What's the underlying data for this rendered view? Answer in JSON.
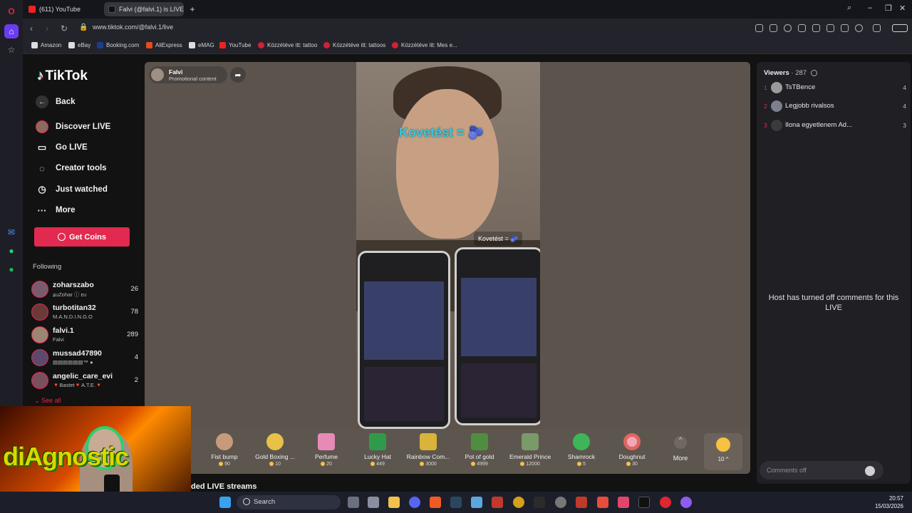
{
  "browser": {
    "tabs": [
      {
        "title": "(611) YouTube"
      },
      {
        "title": "Falvi (@falvi.1) is LIVE"
      }
    ],
    "url": "www.tiktok.com/@falvi.1/live",
    "bookmarks": [
      "Amazon",
      "eBay",
      "Booking.com",
      "AliExpress",
      "eMAG",
      "YouTube",
      "Közzétéve itt: tattoo",
      "Közzétéve itt: tattoos",
      "Közzétéve itt: Mes e..."
    ]
  },
  "sidebar": {
    "logo": "TikTok",
    "back": "Back",
    "nav": [
      "Discover LIVE",
      "Go LIVE",
      "Creator tools",
      "Just watched",
      "More"
    ],
    "get_coins": "Get Coins",
    "following_label": "Following",
    "following": [
      {
        "name": "zoharszabo",
        "sub": "ʑuZohar ⓘ ᴇᴜ",
        "count": "26"
      },
      {
        "name": "turbotitan32",
        "sub": "M.A.N.D.I.N.G.O",
        "count": "78"
      },
      {
        "name": "falvi.1",
        "sub": "Falvi",
        "count": "289"
      },
      {
        "name": "mussad47890",
        "sub": "▤▤▤▤▤▤™ ●",
        "count": "4"
      },
      {
        "name": "angelic_care_evi",
        "sub": "🔻Bastet🔻A.T.E.🔻",
        "count": "2"
      }
    ],
    "see_all": "See all"
  },
  "stream": {
    "host_name": "Falvi",
    "host_sub": "Promotional content",
    "overlay_text": "Kovetést = 🫐",
    "overlay_small": "Kovetést = 🫐"
  },
  "gifts": [
    {
      "name": "Fist bump",
      "cost": "90"
    },
    {
      "name": "Gold Boxing ...",
      "cost": "10"
    },
    {
      "name": "Perfume",
      "cost": "20"
    },
    {
      "name": "Lucky Hat",
      "cost": "449"
    },
    {
      "name": "Rainbow Com...",
      "cost": "3000"
    },
    {
      "name": "Pot of gold",
      "cost": "4999"
    },
    {
      "name": "Emerald Prince",
      "cost": "12000"
    },
    {
      "name": "Shamrock",
      "cost": "5"
    },
    {
      "name": "Doughnut",
      "cost": "30"
    }
  ],
  "gift_more": "More",
  "coin_balance": "10 ^",
  "viewers": {
    "label": "Viewers",
    "count": "· 287",
    "list": [
      {
        "rank": "1",
        "name": "TsTBence",
        "count": "4"
      },
      {
        "rank": "2",
        "name": "Legjobb rivalsos",
        "count": "4"
      },
      {
        "rank": "3",
        "name": "Ilona egyetlenem Ad...",
        "count": "3"
      }
    ]
  },
  "comments_off": "Host has turned off comments for this LIVE",
  "comment_placeholder": "Comments off",
  "recommended_heading": "ded LIVE streams",
  "webcam_text": "diAgnostic",
  "taskbar": {
    "search": "Search",
    "time": "20:57",
    "date": "15/03/2026"
  },
  "colors": {
    "accent": "#e2294f",
    "overlay_text": "#3ec6d8"
  }
}
